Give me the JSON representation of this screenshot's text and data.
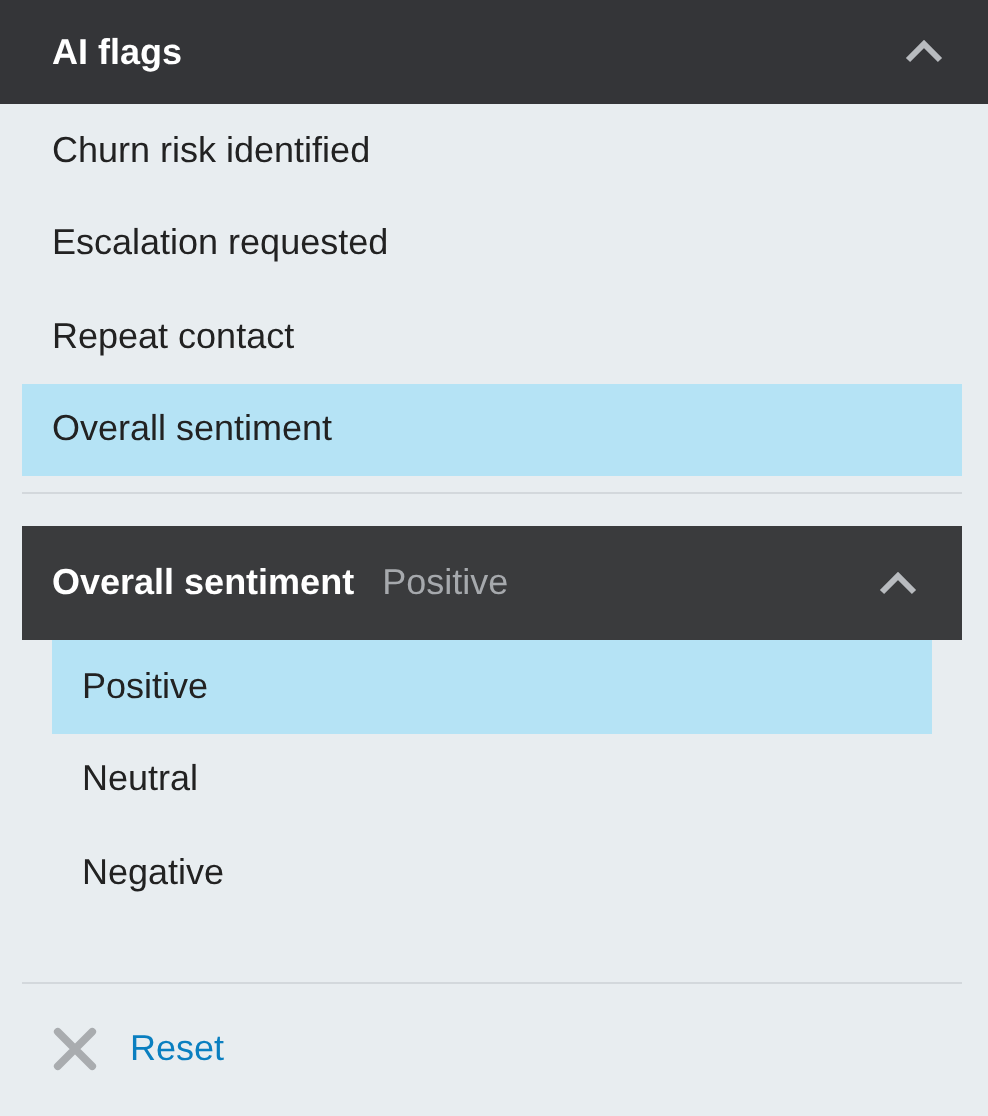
{
  "ai_flags": {
    "title": "AI flags",
    "expanded": true,
    "items": [
      {
        "label": "Churn risk identified",
        "selected": false
      },
      {
        "label": "Escalation requested",
        "selected": false
      },
      {
        "label": "Repeat contact",
        "selected": false
      },
      {
        "label": "Overall sentiment",
        "selected": true
      }
    ]
  },
  "sentiment": {
    "title": "Overall sentiment",
    "value": "Positive",
    "expanded": true,
    "options": [
      {
        "label": "Positive",
        "selected": true
      },
      {
        "label": "Neutral",
        "selected": false
      },
      {
        "label": "Negative",
        "selected": false
      }
    ]
  },
  "reset": {
    "label": "Reset"
  }
}
